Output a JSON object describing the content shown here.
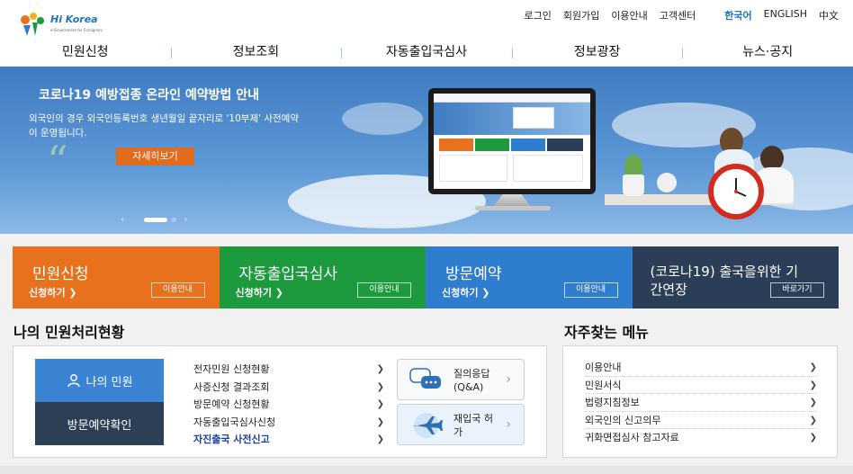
{
  "header": {
    "logo_text": "Hi Korea",
    "logo_sub": "e-Government for Foreigners",
    "utils": [
      "로그인",
      "회원가입",
      "이용안내",
      "고객센터"
    ],
    "languages": [
      "한국어",
      "ENGLISH",
      "中文"
    ],
    "nav": [
      "민원신청",
      "정보조회",
      "자동출입국심사",
      "정보광장",
      "뉴스·공지"
    ],
    "colors": {
      "brand": "#1e73be",
      "nav_divider": "#9ccbe0"
    }
  },
  "hero": {
    "title": "코로나19 예방접종 온라인 예약방법 안내",
    "desc": "외국인의 경우 외국인등록번호 생년월일 끝자리로 '10부제' 사전예약이 운영됩니다.",
    "button": "자세히보기",
    "pager_prev": "‹",
    "pager_next": "›",
    "colors": {
      "sky": "#4f8ccd",
      "button": "#e36b1c"
    }
  },
  "quick": [
    {
      "title": "민원신청",
      "sub": "신청하기 ❯",
      "guide": "이용안내",
      "color": "#e8711d"
    },
    {
      "title": "자동출입국심사",
      "sub": "신청하기 ❯",
      "guide": "이용안내",
      "color": "#1e9a3e"
    },
    {
      "title": "방문예약",
      "sub": "신청하기 ❯",
      "guide": "이용안내",
      "color": "#2f7dcf"
    },
    {
      "title": "(코로나19) 출국을위한 기간연장",
      "sub": "",
      "guide": "바로가기",
      "color": "#2c3e57"
    }
  ],
  "my": {
    "title": "나의 민원처리현황",
    "btn_my": "나의 민원",
    "btn_visit": "방문예약확인",
    "list": [
      "전자민원 신청현황",
      "사증신청 결과조회",
      "방문예약 신청현황",
      "자동출입국심사신청",
      "자진출국 사전신고"
    ],
    "chev": "❯",
    "qa": "질의응답 (Q&A)",
    "reentry": "재입국 허가"
  },
  "freq": {
    "title": "자주찾는 메뉴",
    "items": [
      "이용안내",
      "민원서식",
      "법령지침정보",
      "외국인의 신고의무",
      "귀화면접심사 참고자료"
    ],
    "chev": "❯"
  }
}
